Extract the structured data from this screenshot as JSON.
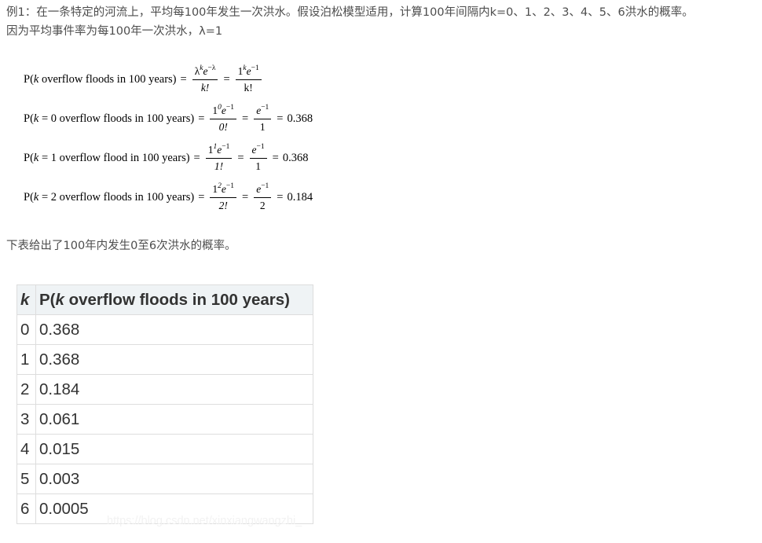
{
  "intro": {
    "line1": "例1：在一条特定的河流上，平均每100年发生一次洪水。假设泊松模型适用，计算100年间隔内k=0、1、2、3、4、5、6洪水的概率。",
    "line2": "因为平均事件率为每100年一次洪水，λ=1"
  },
  "formulas": [
    {
      "lhs_prefix": "P(",
      "lhs_var": "k",
      "lhs_rest": " overflow floods in 100 years)",
      "frac1_num": "λ",
      "frac1_num_sup": "k",
      "frac1_num_tail": "e",
      "frac1_num_tail_sup": "−λ",
      "frac1_den": "k!",
      "frac2_num": "1",
      "frac2_num_sup": "k",
      "frac2_num_tail": "e",
      "frac2_num_tail_sup": "−1",
      "frac2_den": "k!",
      "result": ""
    },
    {
      "lhs_prefix": "P(",
      "lhs_var": "k",
      "lhs_rest": " = 0 overflow floods in 100 years)",
      "frac1_num": "1",
      "frac1_num_sup": "0",
      "frac1_num_tail": "e",
      "frac1_num_tail_sup": "−1",
      "frac1_den": "0!",
      "frac2_num": "",
      "frac2_num_sup": "",
      "frac2_num_tail": "e",
      "frac2_num_tail_sup": "−1",
      "frac2_den": "1",
      "result": "0.368"
    },
    {
      "lhs_prefix": "P(",
      "lhs_var": "k",
      "lhs_rest": " = 1 overflow flood in 100 years)",
      "frac1_num": "1",
      "frac1_num_sup": "1",
      "frac1_num_tail": "e",
      "frac1_num_tail_sup": "−1",
      "frac1_den": "1!",
      "frac2_num": "",
      "frac2_num_sup": "",
      "frac2_num_tail": "e",
      "frac2_num_tail_sup": "−1",
      "frac2_den": "1",
      "result": "0.368"
    },
    {
      "lhs_prefix": "P(",
      "lhs_var": "k",
      "lhs_rest": " = 2 overflow floods in 100 years)",
      "frac1_num": "1",
      "frac1_num_sup": "2",
      "frac1_num_tail": "e",
      "frac1_num_tail_sup": "−1",
      "frac1_den": "2!",
      "frac2_num": "",
      "frac2_num_sup": "",
      "frac2_num_tail": "e",
      "frac2_num_tail_sup": "−1",
      "frac2_den": "2",
      "result": "0.184"
    }
  ],
  "table_intro": "下表给出了100年内发生0至6次洪水的概率。",
  "table": {
    "header_k": "k",
    "header_p_prefix": "P(",
    "header_p_var": "k",
    "header_p_rest": " overflow floods in 100 years)",
    "rows": [
      {
        "k": "0",
        "p": "0.368"
      },
      {
        "k": "1",
        "p": "0.368"
      },
      {
        "k": "2",
        "p": "0.184"
      },
      {
        "k": "3",
        "p": "0.061"
      },
      {
        "k": "4",
        "p": "0.015"
      },
      {
        "k": "5",
        "p": "0.003"
      },
      {
        "k": "6",
        "p": "0.0005"
      }
    ]
  },
  "watermark": "https://blog.csdn.net/xinxiangwangzhi_"
}
